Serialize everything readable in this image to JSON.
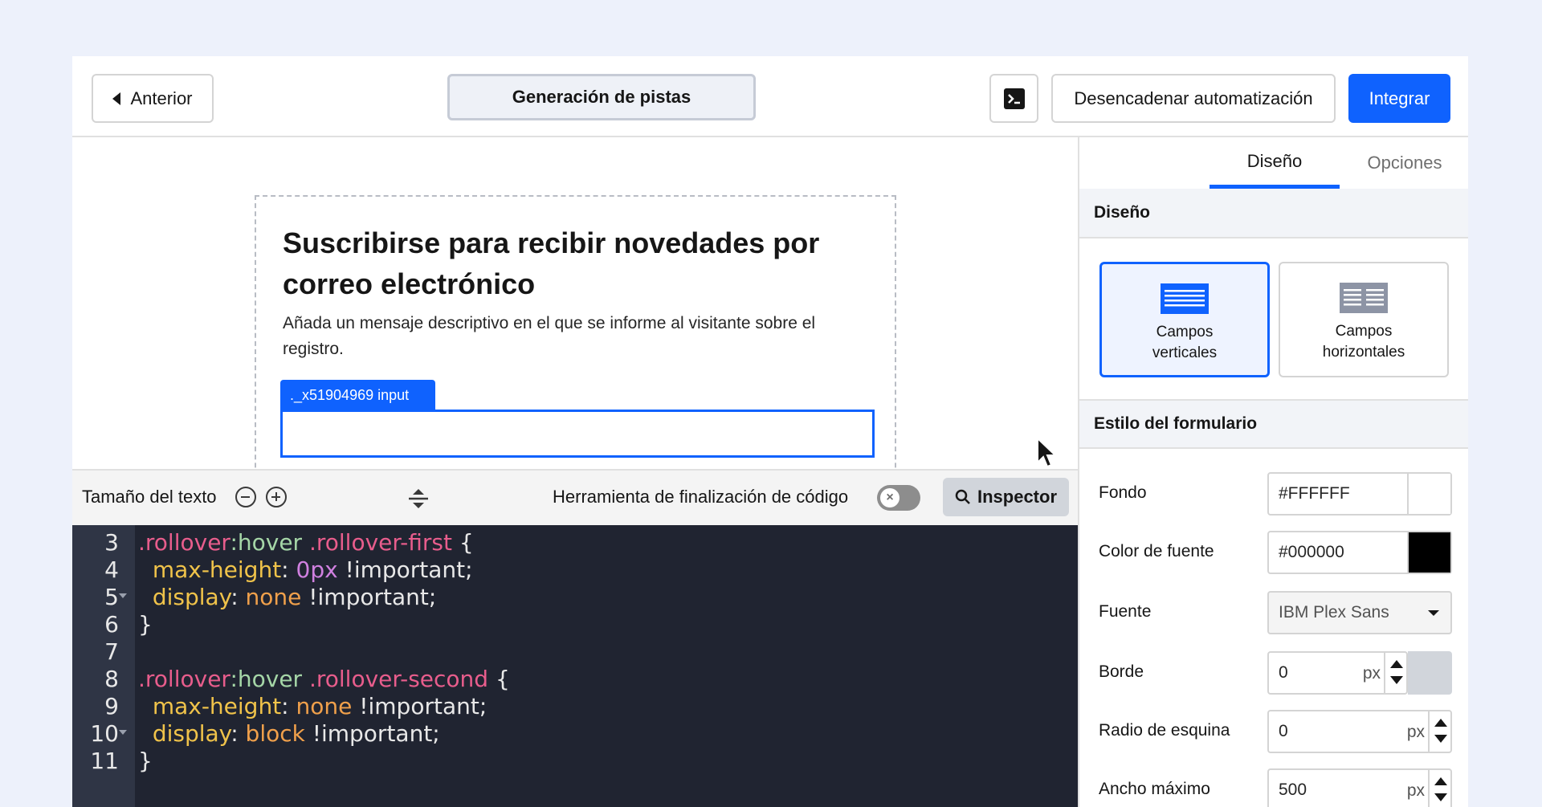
{
  "topbar": {
    "back_label": "Anterior",
    "title": "Generación de pistas",
    "trigger_label": "Desencadenar automatización",
    "integrate_label": "Integrar"
  },
  "form": {
    "title": "Suscribirse para recibir novedades por correo electrónico",
    "description": "Añada un mensaje descriptivo en el que se informe al visitante sobre el registro.",
    "selected_tag": "._x51904969 input"
  },
  "editor_toolbar": {
    "text_size_label": "Tamaño del texto",
    "completion_label": "Herramienta de finalización de código",
    "inspector_label": "Inspector"
  },
  "code_lines": [
    {
      "n": "3",
      "tokens": [
        [
          ".rollover",
          "sel"
        ],
        [
          ":hover",
          "pseudo"
        ],
        [
          " ",
          "pun"
        ],
        [
          ".rollover-first",
          "sel"
        ],
        [
          " {",
          "pun"
        ]
      ]
    },
    {
      "n": "4",
      "tokens": [
        [
          "  ",
          "pun"
        ],
        [
          "max-height",
          "prop"
        ],
        [
          ": ",
          "pun"
        ],
        [
          "0px",
          "num"
        ],
        [
          " !important;",
          "pun"
        ]
      ]
    },
    {
      "n": "5",
      "fold": true,
      "tokens": [
        [
          "  ",
          "pun"
        ],
        [
          "display",
          "prop"
        ],
        [
          ": ",
          "pun"
        ],
        [
          "none",
          "kw"
        ],
        [
          " !important;",
          "pun"
        ]
      ]
    },
    {
      "n": "6",
      "tokens": [
        [
          "}",
          "pun"
        ]
      ]
    },
    {
      "n": "7",
      "tokens": []
    },
    {
      "n": "8",
      "tokens": [
        [
          ".rollover",
          "sel"
        ],
        [
          ":hover",
          "pseudo"
        ],
        [
          " ",
          "pun"
        ],
        [
          ".rollover-second",
          "sel"
        ],
        [
          " {",
          "pun"
        ]
      ]
    },
    {
      "n": "9",
      "tokens": [
        [
          "  ",
          "pun"
        ],
        [
          "max-height",
          "prop"
        ],
        [
          ": ",
          "pun"
        ],
        [
          "none",
          "kw"
        ],
        [
          " !important;",
          "pun"
        ]
      ]
    },
    {
      "n": "10",
      "fold": true,
      "tokens": [
        [
          "  ",
          "pun"
        ],
        [
          "display",
          "prop"
        ],
        [
          ": ",
          "pun"
        ],
        [
          "block",
          "kw"
        ],
        [
          " !important;",
          "pun"
        ]
      ]
    },
    {
      "n": "11",
      "tokens": [
        [
          "}",
          "pun"
        ]
      ]
    }
  ],
  "panel": {
    "tabs": [
      "Diseño",
      "Opciones"
    ],
    "layout_section": "Diseño",
    "layout_vertical": "Campos verticales",
    "layout_horizontal": "Campos horizontales",
    "style_section": "Estilo del formulario",
    "fields": {
      "background_label": "Fondo",
      "background_value": "#FFFFFF",
      "background_color": "#FFFFFF",
      "font_color_label": "Color de fuente",
      "font_color_value": "#000000",
      "font_color_color": "#000000",
      "font_label": "Fuente",
      "font_value": "IBM Plex Sans",
      "border_label": "Borde",
      "border_value": "0",
      "radius_label": "Radio de esquina",
      "radius_value": "0",
      "max_width_label": "Ancho máximo",
      "max_width_value": "500",
      "unit": "px"
    }
  },
  "colors": {
    "accent": "#0f62fe",
    "editor_bg": "#202431",
    "page_bg": "#edf1fb"
  }
}
